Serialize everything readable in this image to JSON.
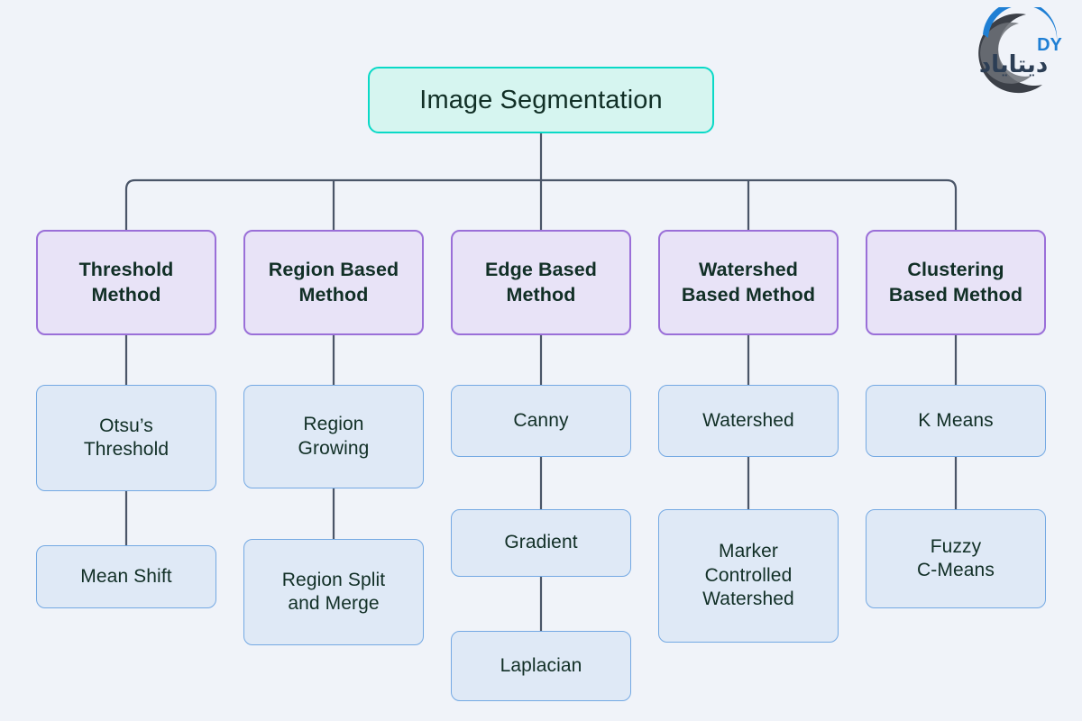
{
  "page": {
    "background_color": "#f0f3f9",
    "text_color": "#112f26",
    "connector_color": "#4a5568"
  },
  "logo": {
    "brand_latin": "DY",
    "brand_script": "دیتایاد",
    "arc_dark_color": "#3b3f47",
    "arc_blue_color": "#1f7fd4",
    "script_color": "#2c3e55"
  },
  "diagram": {
    "type": "tree",
    "title": "Image Segmentation",
    "root": {
      "label": "Image Segmentation",
      "fill": "#d6f5f0",
      "border": "#0ad9c7"
    },
    "branch_style": {
      "fill": "#e8e3f7",
      "border": "#9a6fd8"
    },
    "leaf_style": {
      "fill": "#dfe9f6",
      "border": "#74a9e3"
    },
    "branches": [
      {
        "label": "Threshold\nMethod",
        "children": [
          {
            "label": "Otsu’s\nThreshold"
          },
          {
            "label": "Mean Shift"
          }
        ]
      },
      {
        "label": "Region Based\nMethod",
        "children": [
          {
            "label": "Region\nGrowing"
          },
          {
            "label": "Region Split\nand Merge"
          }
        ]
      },
      {
        "label": "Edge Based\nMethod",
        "children": [
          {
            "label": "Canny"
          },
          {
            "label": "Gradient"
          },
          {
            "label": "Laplacian"
          }
        ]
      },
      {
        "label": "Watershed\nBased Method",
        "children": [
          {
            "label": "Watershed"
          },
          {
            "label": "Marker\nControlled\nWatershed"
          }
        ]
      },
      {
        "label": "Clustering\nBased Method",
        "children": [
          {
            "label": "K Means"
          },
          {
            "label": "Fuzzy\nC-Means"
          }
        ]
      }
    ]
  }
}
